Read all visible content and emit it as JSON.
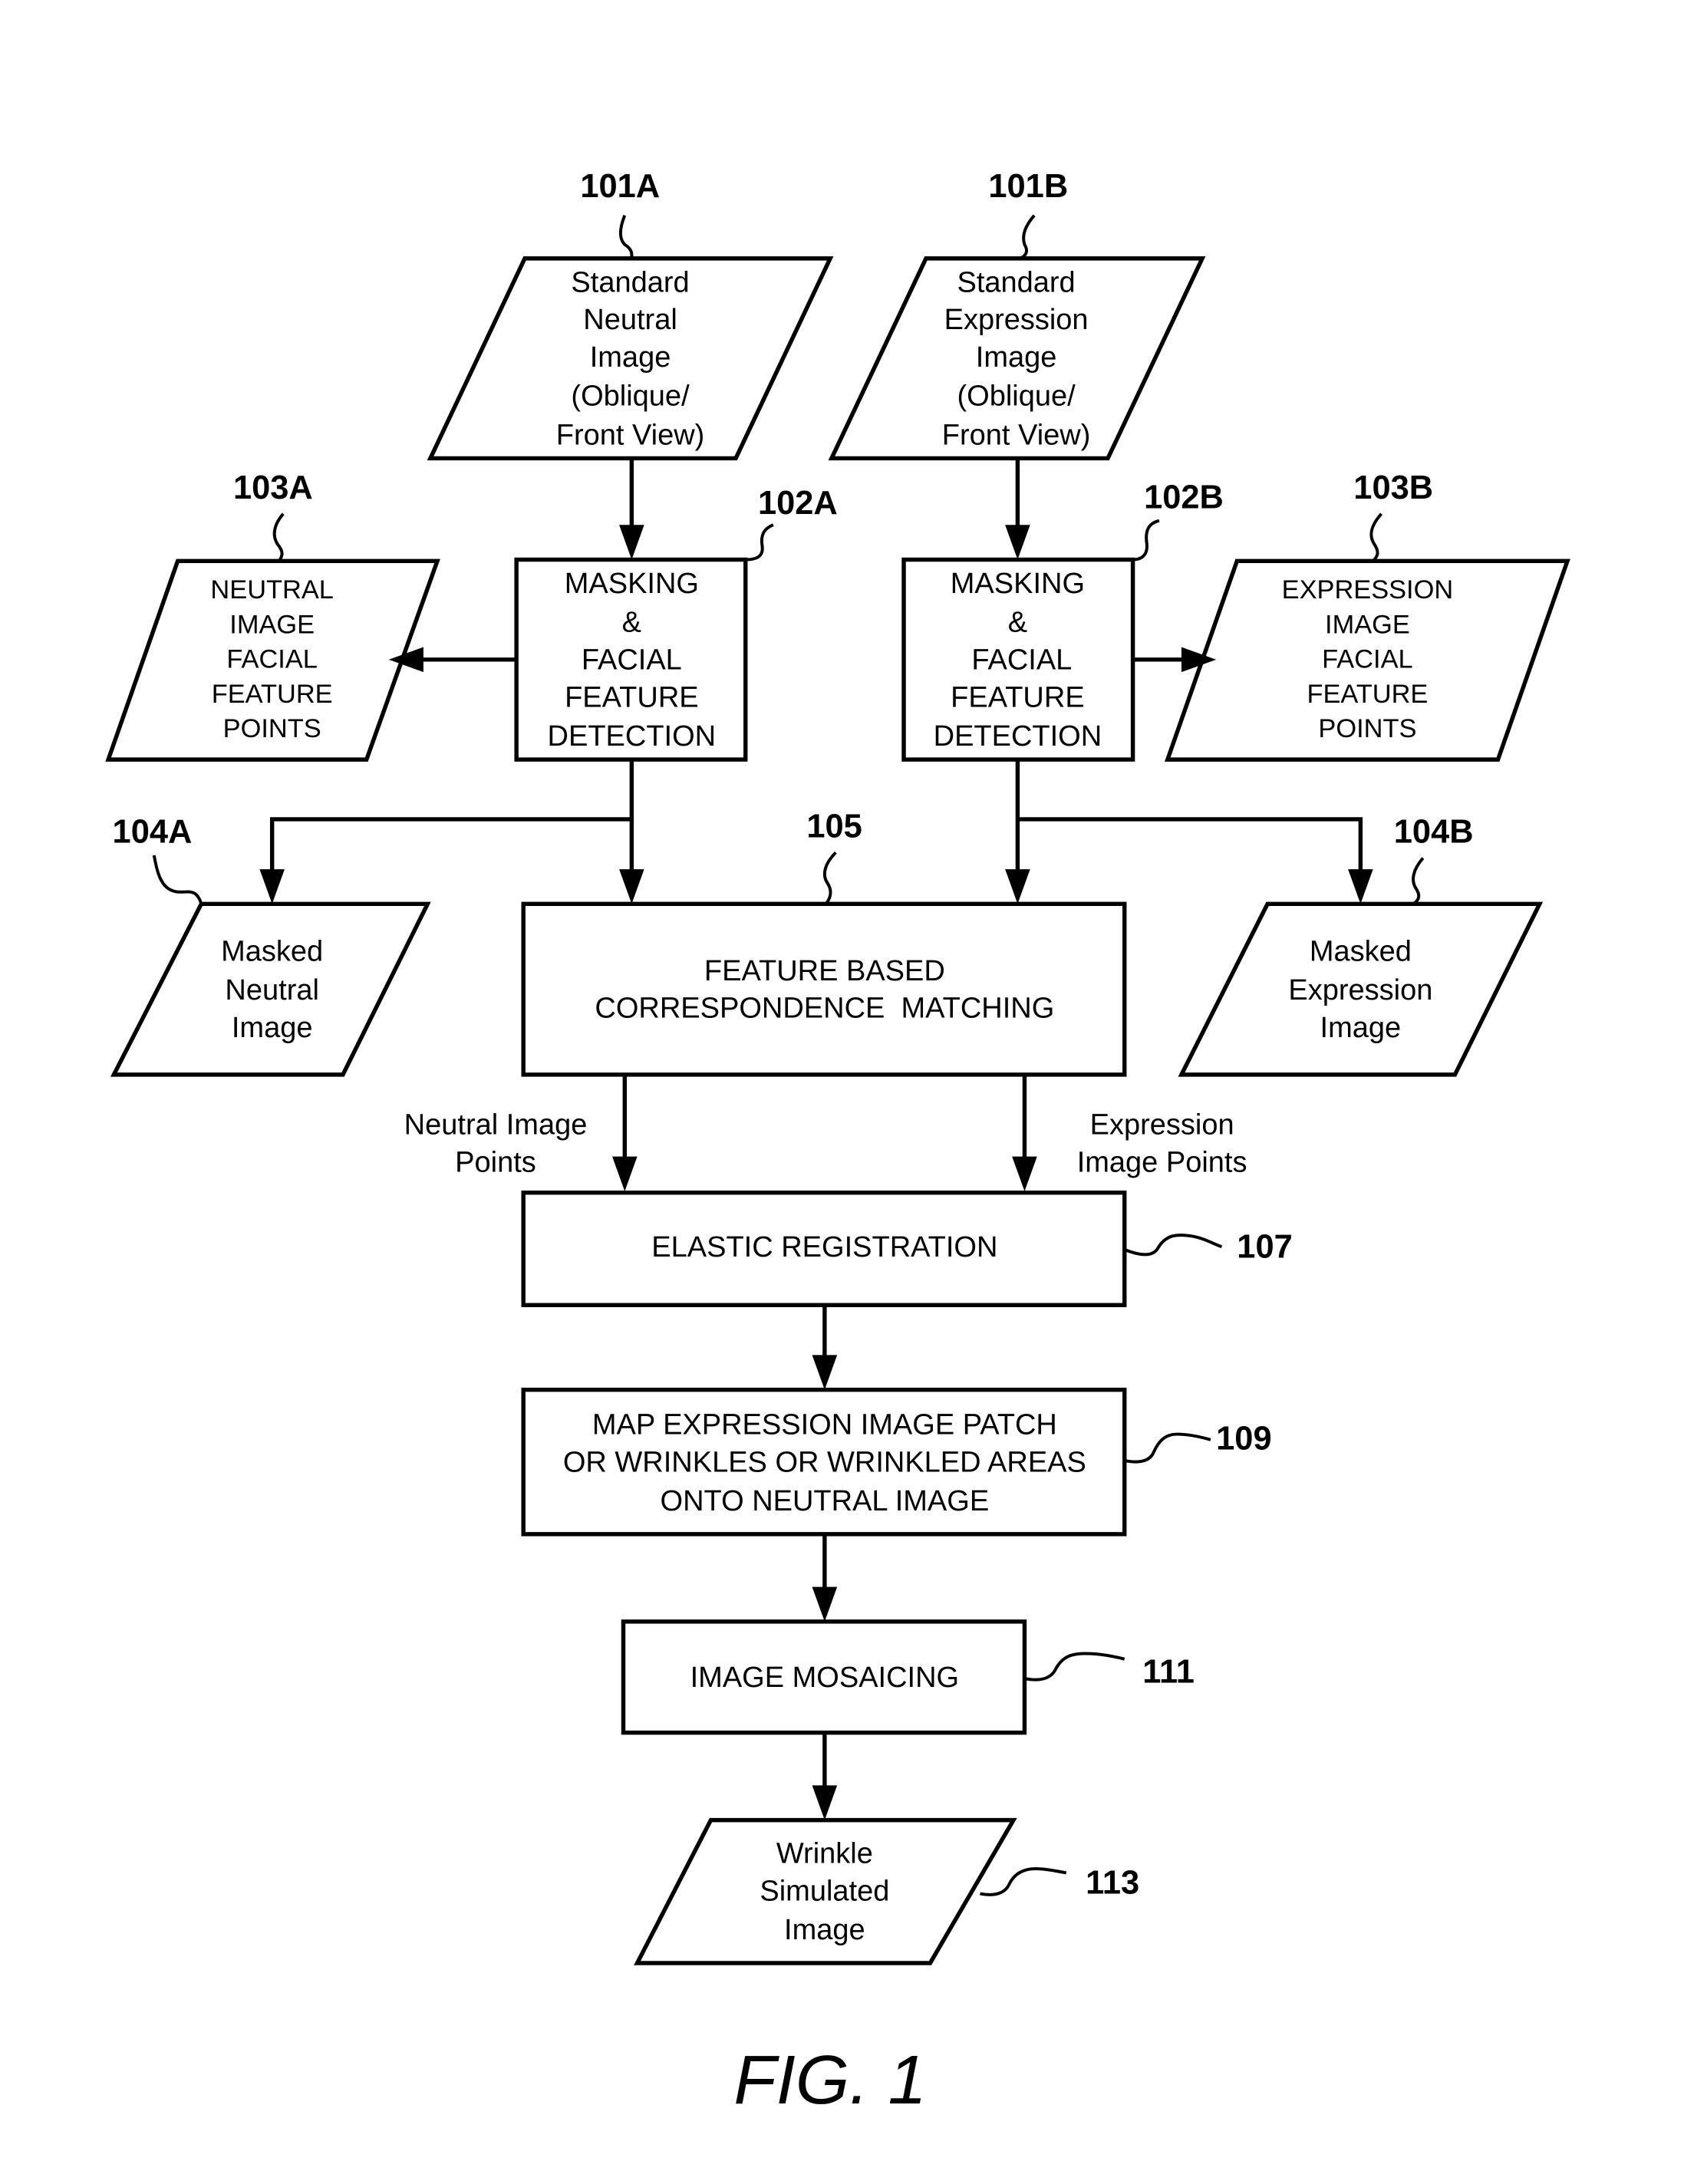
{
  "figure": {
    "caption": "FIG. 1",
    "nodes": [
      {
        "id": "101A",
        "ref": "101A",
        "shape": "parallelogram",
        "lines": [
          "Standard",
          "Neutral",
          "Image",
          "(Oblique/",
          "Front View)"
        ]
      },
      {
        "id": "101B",
        "ref": "101B",
        "shape": "parallelogram",
        "lines": [
          "Standard",
          "Expression",
          "Image",
          "(Oblique/",
          "Front View)"
        ]
      },
      {
        "id": "102A",
        "ref": "102A",
        "shape": "rectangle",
        "lines": [
          "MASKING",
          "&",
          "FACIAL",
          "FEATURE",
          "DETECTION"
        ]
      },
      {
        "id": "102B",
        "ref": "102B",
        "shape": "rectangle",
        "lines": [
          "MASKING",
          "&",
          "FACIAL",
          "FEATURE",
          "DETECTION"
        ]
      },
      {
        "id": "103A",
        "ref": "103A",
        "shape": "parallelogram",
        "lines": [
          "NEUTRAL",
          "IMAGE",
          "FACIAL",
          "FEATURE",
          "POINTS"
        ]
      },
      {
        "id": "103B",
        "ref": "103B",
        "shape": "parallelogram",
        "lines": [
          "EXPRESSION",
          "IMAGE",
          "FACIAL",
          "FEATURE",
          "POINTS"
        ]
      },
      {
        "id": "104A",
        "ref": "104A",
        "shape": "parallelogram",
        "lines": [
          "Masked",
          "Neutral",
          "Image"
        ]
      },
      {
        "id": "104B",
        "ref": "104B",
        "shape": "parallelogram",
        "lines": [
          "Masked",
          "Expression",
          "Image"
        ]
      },
      {
        "id": "105",
        "ref": "105",
        "shape": "rectangle",
        "lines": [
          "FEATURE BASED",
          "CORRESPONDENCE  MATCHING"
        ]
      },
      {
        "id": "107",
        "ref": "107",
        "shape": "rectangle",
        "lines": [
          "ELASTIC REGISTRATION"
        ]
      },
      {
        "id": "109",
        "ref": "109",
        "shape": "rectangle",
        "lines": [
          "MAP EXPRESSION IMAGE PATCH",
          "OR WRINKLES OR WRINKLED AREAS",
          "ONTO NEUTRAL IMAGE"
        ]
      },
      {
        "id": "111",
        "ref": "111",
        "shape": "rectangle",
        "lines": [
          "IMAGE MOSAICING"
        ]
      },
      {
        "id": "113",
        "ref": "113",
        "shape": "parallelogram",
        "lines": [
          "Wrinkle",
          "Simulated",
          "Image"
        ]
      }
    ],
    "edges": [
      {
        "from": "101A",
        "to": "102A"
      },
      {
        "from": "101B",
        "to": "102B"
      },
      {
        "from": "102A",
        "to": "103A"
      },
      {
        "from": "102B",
        "to": "103B"
      },
      {
        "from": "102A",
        "to": "104A"
      },
      {
        "from": "102A",
        "to": "105"
      },
      {
        "from": "102B",
        "to": "105"
      },
      {
        "from": "102B",
        "to": "104B"
      },
      {
        "from": "105",
        "to": "107",
        "label": [
          "Neutral Image",
          "Points"
        ]
      },
      {
        "from": "105",
        "to": "107",
        "label": [
          "Expression",
          "Image Points"
        ]
      },
      {
        "from": "107",
        "to": "109"
      },
      {
        "from": "109",
        "to": "111"
      },
      {
        "from": "111",
        "to": "113"
      }
    ],
    "edge_labels": {
      "neutral_points": [
        "Neutral Image",
        "Points"
      ],
      "expression_points": [
        "Expression",
        "Image Points"
      ]
    }
  }
}
